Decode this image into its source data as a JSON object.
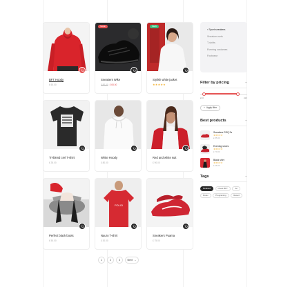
{
  "products": [
    {
      "name": "BFT Hoody",
      "price": "£ 60.00",
      "old_price": "",
      "stars": "",
      "badge": "",
      "underline": true,
      "cart_style": "red"
    },
    {
      "name": "Sneakers Wike",
      "price": "£ 65.00",
      "old_price": "£ 90.00",
      "stars": "",
      "badge": "SALE",
      "badge_color": "#e55353",
      "underline": false,
      "cart_style": "dark"
    },
    {
      "name": "Stylish white jacket",
      "price": "",
      "old_price": "",
      "stars": "★★★★★",
      "badge": "NEW",
      "badge_color": "#3fbf7f",
      "underline": false,
      "cart_style": "dark"
    },
    {
      "name": "Tri-blend crel T-shirt",
      "price": "£ 35.00",
      "old_price": "",
      "stars": "",
      "badge": "",
      "underline": false,
      "cart_style": "dark"
    },
    {
      "name": "White Hoody",
      "price": "£ 80.00",
      "old_price": "",
      "stars": "",
      "badge": "",
      "underline": false,
      "cart_style": "dark"
    },
    {
      "name": "Red and white suit",
      "price": "£ 90.00",
      "old_price": "",
      "stars": "",
      "badge": "",
      "underline": false,
      "cart_style": "dark"
    },
    {
      "name": "Perfect black boots",
      "price": "£ 50.00",
      "old_price": "",
      "stars": "",
      "badge": "",
      "underline": false,
      "cart_style": "dark"
    },
    {
      "name": "Nauro T-shirt",
      "price": "£ 30.00",
      "old_price": "",
      "stars": "",
      "badge": "",
      "underline": false,
      "cart_style": "dark"
    },
    {
      "name": "Sneakers Puama",
      "price": "£ 75.00",
      "old_price": "",
      "stars": "",
      "badge": "",
      "underline": false,
      "cart_style": "dark"
    }
  ],
  "categories": {
    "items": [
      "Sport sneakers",
      "Sneakers sets",
      "T-shirts",
      "Evening costumes",
      "Footwear"
    ],
    "active_index": 0
  },
  "filter": {
    "title": "Filter by pricing",
    "min_label": "£30",
    "max_label": "£90",
    "range_low": 0.08,
    "range_high": 0.8,
    "button": "Apply filter"
  },
  "best_products": {
    "title": "Best products",
    "items": [
      {
        "name": "Sneakers RSQ 2s",
        "stars": "★★★★★",
        "price": "£ 85.00"
      },
      {
        "name": "Evening shoes",
        "stars": "★★★★★",
        "price": "£ 70.00"
      },
      {
        "name": "Black shirt",
        "stars": "★★★★★",
        "price": "£ 45.00"
      }
    ]
  },
  "tags": {
    "title": "Tags",
    "items": [
      "Relaxed",
      "Chest BFT",
      "Air",
      "Rulex",
      "Programing",
      "Resort"
    ],
    "active_index": 0
  },
  "pagination": {
    "pages": [
      "1",
      "2",
      "3"
    ],
    "next": "Next"
  },
  "colors": {
    "accent": "#e55353",
    "new_badge": "#3fbf7f",
    "star": "#f2b233"
  }
}
